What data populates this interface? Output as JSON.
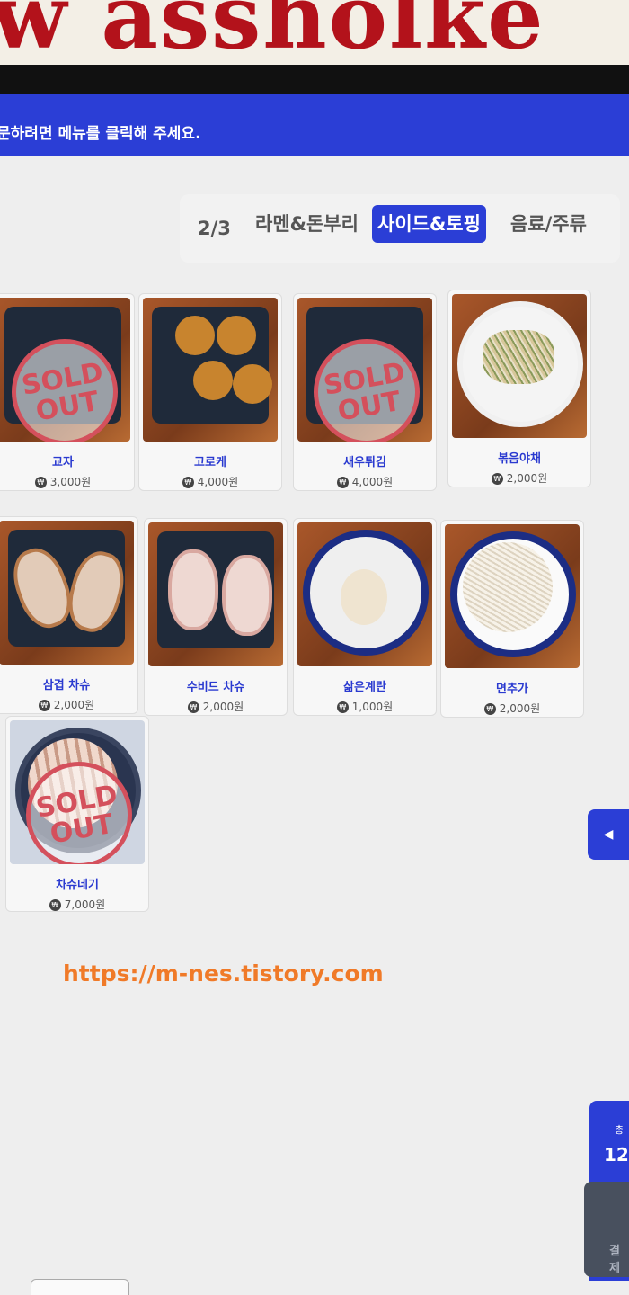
{
  "sign": {
    "text": "w assholke"
  },
  "banner": {
    "text": "문하려면 메뉴를 클릭해 주세요."
  },
  "tabs": {
    "page_indicator": "2/3",
    "items": [
      {
        "label": "라멘&돈부리",
        "active": false
      },
      {
        "label": "사이드&토핑",
        "active": true
      },
      {
        "label": "음료/주류",
        "active": false
      }
    ]
  },
  "currency_symbol": "₩",
  "menu": [
    {
      "name": "교자",
      "price": "3,000원",
      "sold_out": true
    },
    {
      "name": "고로케",
      "price": "4,000원",
      "sold_out": false
    },
    {
      "name": "새우튀김",
      "price": "4,000원",
      "sold_out": true
    },
    {
      "name": "볶음야채",
      "price": "2,000원",
      "sold_out": false
    },
    {
      "name": "삼겹 차슈",
      "price": "2,000원",
      "sold_out": false
    },
    {
      "name": "수비드 차슈",
      "price": "2,000원",
      "sold_out": false
    },
    {
      "name": "삶은계란",
      "price": "1,000원",
      "sold_out": false
    },
    {
      "name": "면추가",
      "price": "2,000원",
      "sold_out": false
    },
    {
      "name": "차슈네기",
      "price": "7,000원",
      "sold_out": true
    }
  ],
  "soldout_label": {
    "line1": "SOLD",
    "line2": "OUT"
  },
  "side": {
    "arrow": "◀",
    "panel_top": "총",
    "panel_amount": "12,",
    "pay_label": "결제"
  },
  "watermark": "https://m-nes.tistory.com",
  "colors": {
    "accent": "#2b3ed6",
    "soldout": "#d4505c",
    "watermark": "#f07a28"
  }
}
